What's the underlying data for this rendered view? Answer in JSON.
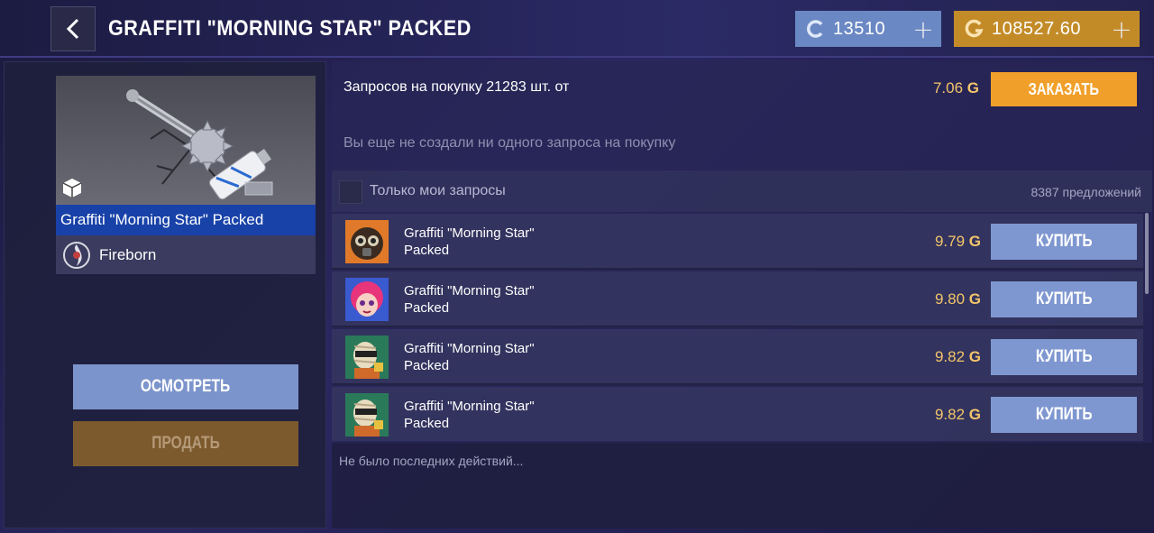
{
  "header": {
    "title": "GRAFFITI \"MORNING STAR\" PACKED",
    "silver_balance": "13510",
    "gold_balance": "108527.60",
    "plus": "+"
  },
  "item": {
    "name": "Graffiti \"Morning Star\" Packed",
    "collection": "Fireborn"
  },
  "actions": {
    "inspect": "ОСМОТРЕТЬ",
    "sell": "ПРОДАТЬ"
  },
  "buy_requests": {
    "summary": "Запросов на покупку 21283 шт. от",
    "min_price": "7.06",
    "order_button": "ЗАКАЗАТЬ",
    "empty_message": "Вы еще не создали ни одного запроса на покупку"
  },
  "filter": {
    "only_mine_label": "Только мои запросы",
    "offers_count": "8387 предложений"
  },
  "currency_symbol": "G",
  "listings": [
    {
      "name_line1": "Graffiti \"Morning Star\"",
      "name_line2": "Packed",
      "price": "9.79",
      "buy": "КУПИТЬ",
      "avatar": "gasmask-avatar"
    },
    {
      "name_line1": "Graffiti \"Morning Star\"",
      "name_line2": "Packed",
      "price": "9.80",
      "buy": "КУПИТЬ",
      "avatar": "pink-hair-avatar"
    },
    {
      "name_line1": "Graffiti \"Morning Star\"",
      "name_line2": "Packed",
      "price": "9.82",
      "buy": "КУПИТЬ",
      "avatar": "mummy-avatar"
    },
    {
      "name_line1": "Graffiti \"Morning Star\"",
      "name_line2": "Packed",
      "price": "9.82",
      "buy": "КУПИТЬ",
      "avatar": "mummy-avatar"
    }
  ],
  "recent": {
    "text": "Не было последних действий..."
  },
  "colors": {
    "silver": "#6a88c4",
    "gold": "#c38b28",
    "price": "#f3c56a",
    "order": "#f0a02a",
    "buy": "#7f97d0",
    "name_bar": "#1842a8"
  }
}
